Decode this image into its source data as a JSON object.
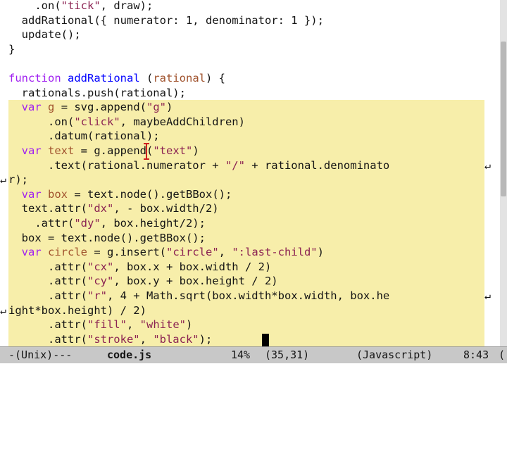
{
  "colors": {
    "keyword": "#a020f0",
    "function_name": "#0000ff",
    "variable": "#a0522d",
    "string": "#8b2252",
    "plain": "#141414",
    "region": "#f7eeaa"
  },
  "editor": {
    "lines": [
      [
        {
          "t": "    .on(",
          "c": "plain"
        },
        {
          "t": "\"tick\"",
          "c": "string"
        },
        {
          "t": ", draw);",
          "c": "plain"
        }
      ],
      [
        {
          "t": "  addRational({ numerator: 1, denominator: 1 });",
          "c": "plain"
        }
      ],
      [
        {
          "t": "  update();",
          "c": "plain"
        }
      ],
      [
        {
          "t": "}",
          "c": "plain"
        }
      ],
      [
        {
          "t": "",
          "c": "plain"
        }
      ],
      [
        {
          "t": "function",
          "c": "keyword"
        },
        {
          "t": " ",
          "c": "plain"
        },
        {
          "t": "addRational",
          "c": "function_name"
        },
        {
          "t": " (",
          "c": "plain"
        },
        {
          "t": "rational",
          "c": "variable"
        },
        {
          "t": ") {",
          "c": "plain"
        }
      ],
      [
        {
          "t": "  rationals.push(rational);",
          "c": "plain"
        }
      ],
      [
        {
          "t": "  ",
          "c": "plain"
        },
        {
          "t": "var",
          "c": "keyword"
        },
        {
          "t": " ",
          "c": "plain"
        },
        {
          "t": "g",
          "c": "variable"
        },
        {
          "t": " = svg.append(",
          "c": "plain"
        },
        {
          "t": "\"g\"",
          "c": "string"
        },
        {
          "t": ")",
          "c": "plain"
        }
      ],
      [
        {
          "t": "      .on(",
          "c": "plain"
        },
        {
          "t": "\"click\"",
          "c": "string"
        },
        {
          "t": ", maybeAddChildren)",
          "c": "plain"
        }
      ],
      [
        {
          "t": "      .datum(rational);",
          "c": "plain"
        }
      ],
      [
        {
          "t": "  ",
          "c": "plain"
        },
        {
          "t": "var",
          "c": "keyword"
        },
        {
          "t": " ",
          "c": "plain"
        },
        {
          "t": "text",
          "c": "variable"
        },
        {
          "t": " = g.append(",
          "c": "plain"
        },
        {
          "t": "\"text\"",
          "c": "string"
        },
        {
          "t": ")",
          "c": "plain"
        }
      ],
      [
        {
          "t": "      .text(rational.numerator + ",
          "c": "plain"
        },
        {
          "t": "\"/\"",
          "c": "string"
        },
        {
          "t": " + rational.denominato",
          "c": "plain"
        }
      ],
      [
        {
          "t": "r);",
          "c": "plain"
        }
      ],
      [
        {
          "t": "  ",
          "c": "plain"
        },
        {
          "t": "var",
          "c": "keyword"
        },
        {
          "t": " ",
          "c": "plain"
        },
        {
          "t": "box",
          "c": "variable"
        },
        {
          "t": " = text.node().getBBox();",
          "c": "plain"
        }
      ],
      [
        {
          "t": "  text.attr(",
          "c": "plain"
        },
        {
          "t": "\"dx\"",
          "c": "string"
        },
        {
          "t": ", - box.width/2)",
          "c": "plain"
        }
      ],
      [
        {
          "t": "    .attr(",
          "c": "plain"
        },
        {
          "t": "\"dy\"",
          "c": "string"
        },
        {
          "t": ", box.height/2);",
          "c": "plain"
        }
      ],
      [
        {
          "t": "  box = text.node().getBBox();",
          "c": "plain"
        }
      ],
      [
        {
          "t": "  ",
          "c": "plain"
        },
        {
          "t": "var",
          "c": "keyword"
        },
        {
          "t": " ",
          "c": "plain"
        },
        {
          "t": "circle",
          "c": "variable"
        },
        {
          "t": " = g.insert(",
          "c": "plain"
        },
        {
          "t": "\"circle\"",
          "c": "string"
        },
        {
          "t": ", ",
          "c": "plain"
        },
        {
          "t": "\":last-child\"",
          "c": "string"
        },
        {
          "t": ")",
          "c": "plain"
        }
      ],
      [
        {
          "t": "      .attr(",
          "c": "plain"
        },
        {
          "t": "\"cx\"",
          "c": "string"
        },
        {
          "t": ", box.x + box.width / 2)",
          "c": "plain"
        }
      ],
      [
        {
          "t": "      .attr(",
          "c": "plain"
        },
        {
          "t": "\"cy\"",
          "c": "string"
        },
        {
          "t": ", box.y + box.height / 2)",
          "c": "plain"
        }
      ],
      [
        {
          "t": "      .attr(",
          "c": "plain"
        },
        {
          "t": "\"r\"",
          "c": "string"
        },
        {
          "t": ", 4 + Math.sqrt(box.width*box.width, box.he",
          "c": "plain"
        }
      ],
      [
        {
          "t": "ight*box.height) / 2)",
          "c": "plain"
        }
      ],
      [
        {
          "t": "      .attr(",
          "c": "plain"
        },
        {
          "t": "\"fill\"",
          "c": "string"
        },
        {
          "t": ", ",
          "c": "plain"
        },
        {
          "t": "\"white\"",
          "c": "string"
        },
        {
          "t": ")",
          "c": "plain"
        }
      ],
      [
        {
          "t": "      .attr(",
          "c": "plain"
        },
        {
          "t": "\"stroke\"",
          "c": "string"
        },
        {
          "t": ", ",
          "c": "plain"
        },
        {
          "t": "\"black\"",
          "c": "string"
        },
        {
          "t": ");",
          "c": "plain"
        }
      ]
    ],
    "wrap_glyph": "↵",
    "scroll_fraction": 0.14
  },
  "modeline": {
    "status": "-(Unix)---",
    "buffer_name": "code.js",
    "percent": "14%",
    "position": "(35,31)",
    "mode": "(Javascript)",
    "time": "8:43",
    "tail": "("
  }
}
